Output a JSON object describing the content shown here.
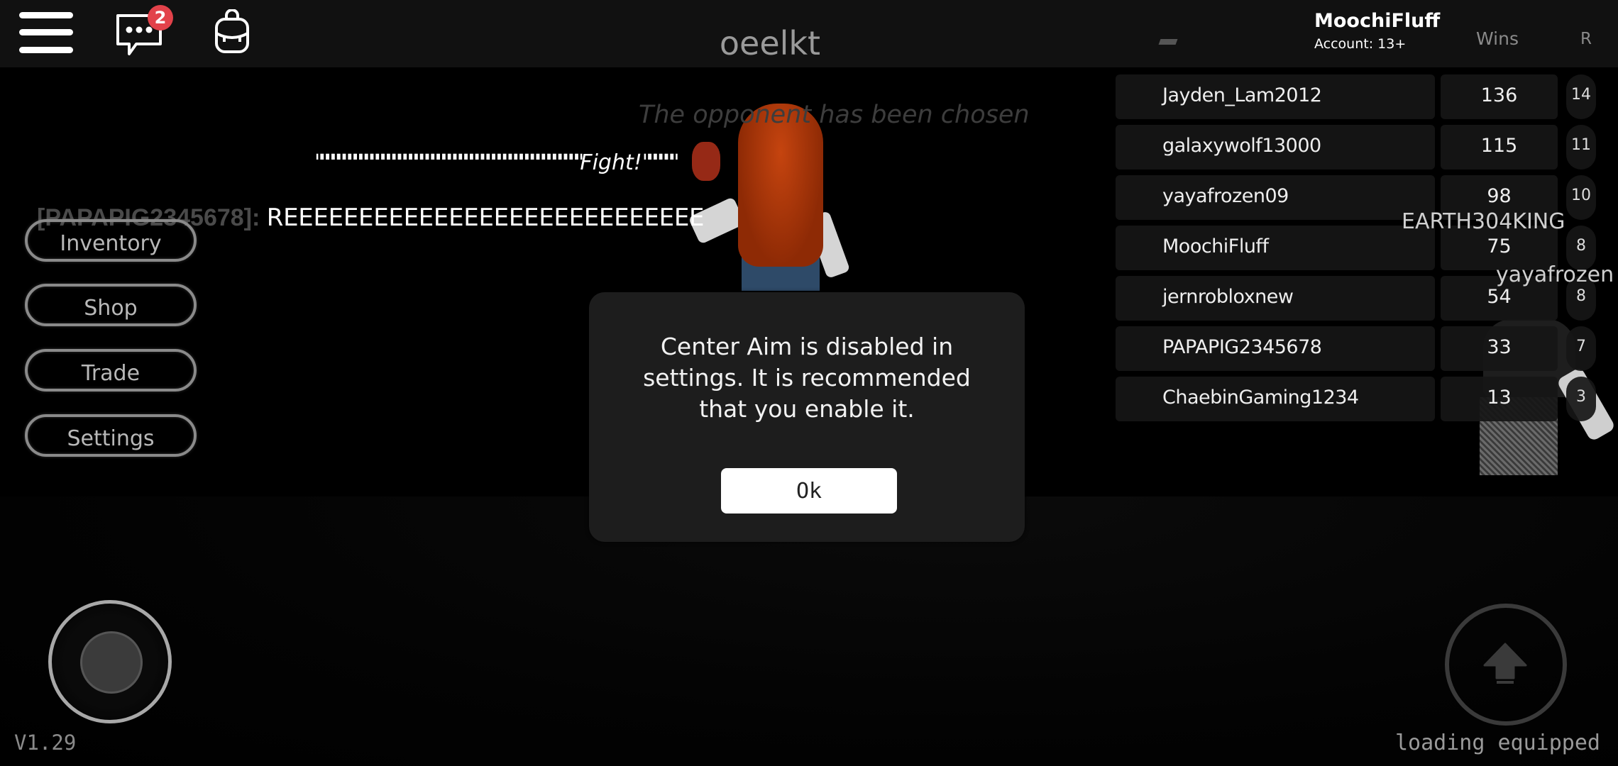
{
  "topbar": {
    "server_name": "oeelkt",
    "chat_badge_count": "2",
    "icons": [
      "menu-icon",
      "chat-icon",
      "backpack-icon"
    ]
  },
  "leaderboard": {
    "current_user": "MoochiFluff",
    "account_label": "Account: 13+",
    "columns": [
      "Wins",
      "R"
    ],
    "rows": [
      {
        "name": "Jayden_Lam2012",
        "wins": "136",
        "r": "14"
      },
      {
        "name": "galaxywolf13000",
        "wins": "115",
        "r": "11"
      },
      {
        "name": "yayafrozen09",
        "wins": "98",
        "r": "10"
      },
      {
        "name": "MoochiFluff",
        "wins": "75",
        "r": "8"
      },
      {
        "name": "jernrobloxnew",
        "wins": "54",
        "r": "8"
      },
      {
        "name": "PAPAPIG2345678",
        "wins": "33",
        "r": "7"
      },
      {
        "name": "ChaebinGaming1234",
        "wins": "13",
        "r": "3"
      }
    ]
  },
  "scene": {
    "opponent_message": "The opponent has been chosen",
    "fight_prefix": "\"\"\"\"\"\"\"\"\"\"\"\"\"\"\"\"\"\"\"\"\"\"\"\"\"\"\"\"\"\"\"\"\"\"\"\"\"\"\"\"\"\"\"\"\"\"\"\"",
    "fight_word": "Fight!",
    "fight_suffix": "\"\"\"\"\"\"",
    "player_tags": [
      "EARTH304KING",
      "yayafrozen"
    ]
  },
  "chat": {
    "sender": "[PAPAPIG2345678]:",
    "message": "REEEEEEEEEEEEEEEEEEEEEEEEEEEE"
  },
  "side_menu": {
    "inventory": "Inventory",
    "shop": "Shop",
    "trade": "Trade",
    "settings": "Settings"
  },
  "dialog": {
    "message": "Center Aim is disabled in settings. It is recommended that you enable it.",
    "ok_label": "Ok"
  },
  "footer": {
    "version": "V1.29",
    "status": "loading equipped"
  },
  "colors": {
    "topbar_bg": "#111111",
    "badge": "#e2424a",
    "dialog_bg": "#1d1d1d",
    "button_outline": "#8a8a8a"
  }
}
